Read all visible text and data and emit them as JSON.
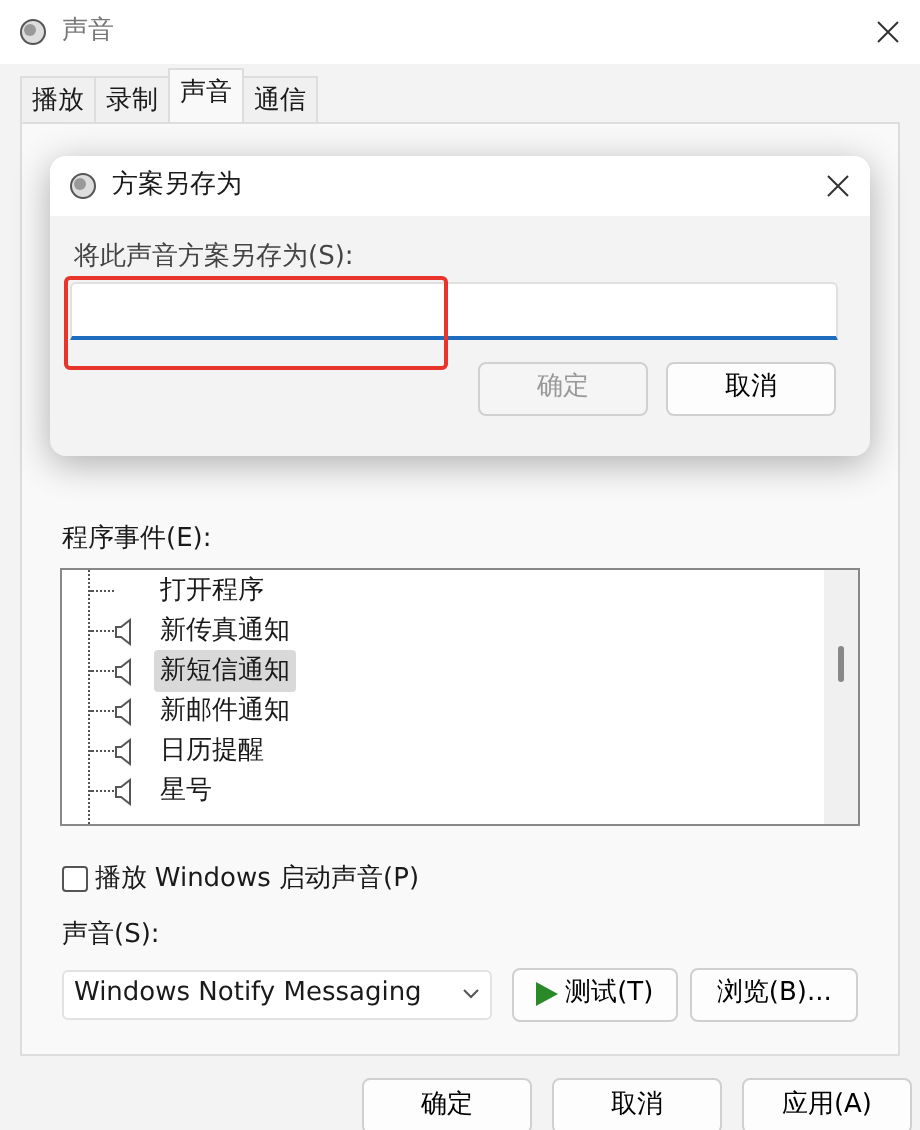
{
  "window": {
    "title": "声音"
  },
  "tabs": [
    {
      "label": "播放",
      "selected": false
    },
    {
      "label": "录制",
      "selected": false
    },
    {
      "label": "声音",
      "selected": true
    },
    {
      "label": "通信",
      "selected": false
    }
  ],
  "dialog": {
    "title": "方案另存为",
    "field_label": "将此声音方案另存为(S):",
    "focused": true,
    "buttons": [
      {
        "label": "确定",
        "disabled": true
      },
      {
        "label": "取消",
        "disabled": false
      }
    ]
  },
  "events_label": "程序事件(E):",
  "events": [
    {
      "label": "打开程序",
      "has_sound": false,
      "selected": false
    },
    {
      "label": "新传真通知",
      "has_sound": true,
      "selected": false
    },
    {
      "label": "新短信通知",
      "has_sound": true,
      "selected": true
    },
    {
      "label": "新邮件通知",
      "has_sound": true,
      "selected": false
    },
    {
      "label": "日历提醒",
      "has_sound": true,
      "selected": false
    },
    {
      "label": "星号",
      "has_sound": true,
      "selected": false
    }
  ],
  "startup_sound": {
    "label": "播放 Windows 启动声音(P)",
    "checked": false
  },
  "sound_label": "声音(S):",
  "sound_select": {
    "value": "Windows Notify Messaging"
  },
  "test_button": "测试(T)",
  "browse_button": "浏览(B)...",
  "footer_buttons": [
    "确定",
    "取消",
    "应用(A)"
  ]
}
